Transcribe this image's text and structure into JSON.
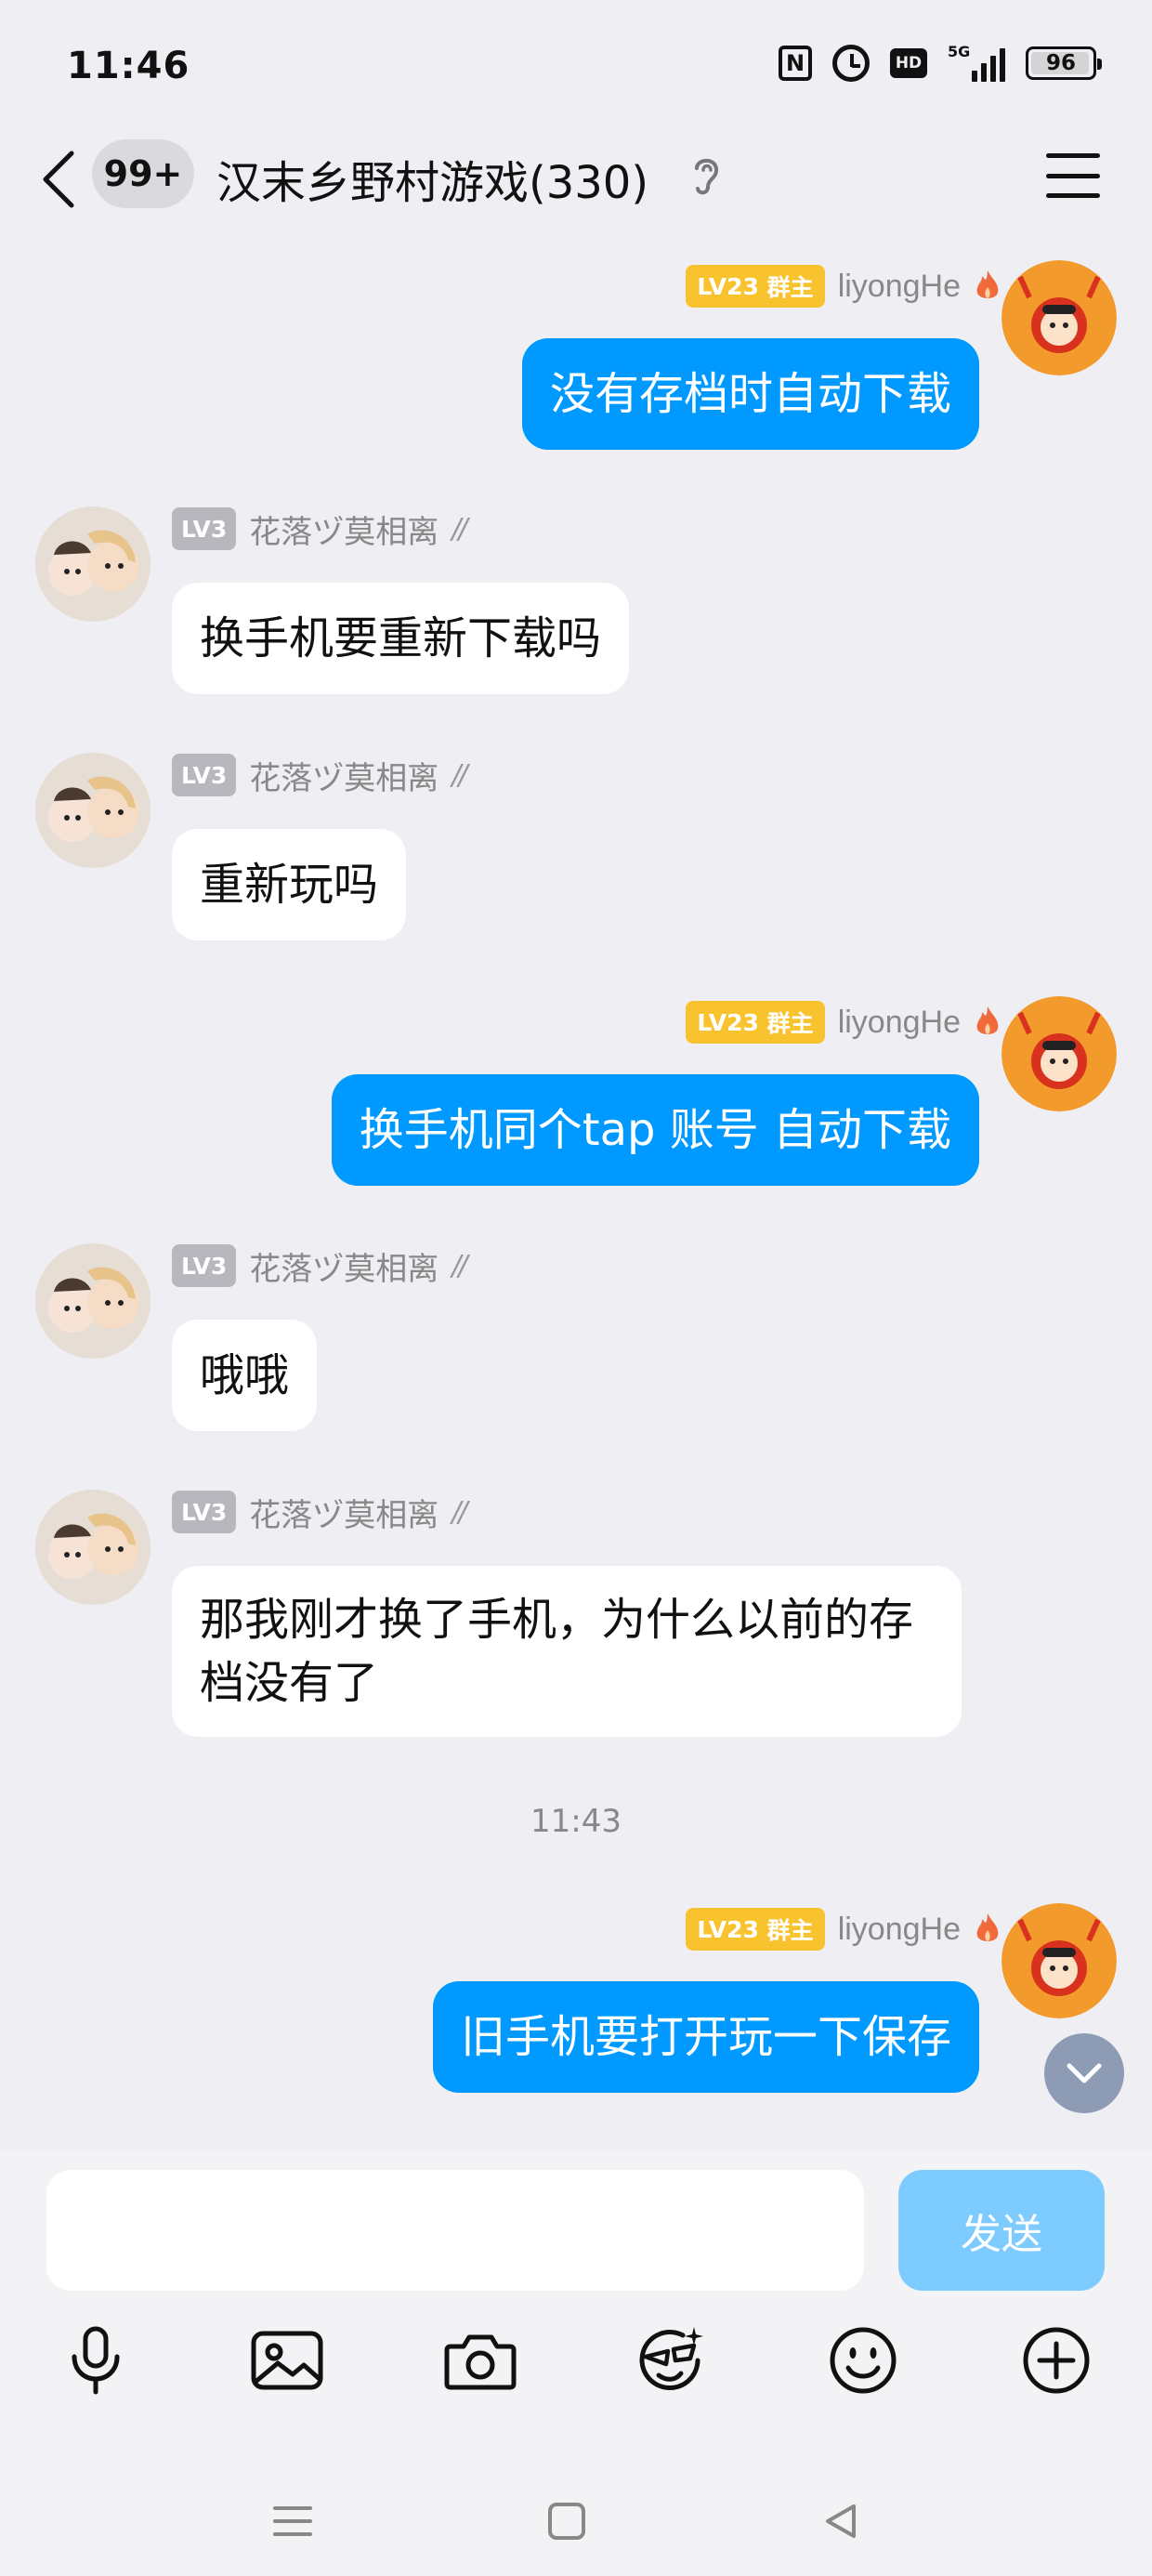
{
  "status_bar": {
    "time": "11:46",
    "network": "5G",
    "battery": "96",
    "icons": [
      "nfc-icon",
      "alarm-icon",
      "hd-icon",
      "signal-icon",
      "battery-icon"
    ]
  },
  "header": {
    "unread_count": "99+",
    "title": "汉末乡野村游戏(330)",
    "icons": [
      "back-arrow-icon",
      "ear-icon",
      "menu-icon"
    ]
  },
  "colors": {
    "outgoing_bubble": "#0099ff",
    "incoming_bubble": "#ffffff",
    "background": "#eeeef3",
    "owner_badge": "#f8c32f",
    "level_badge": "#b7b7bd",
    "send_button": "#7ecbff"
  },
  "messages": [
    {
      "direction": "out",
      "level": "LV23",
      "role": "群主",
      "sender": "liyongHe",
      "text": "没有存档时自动下载"
    },
    {
      "direction": "in",
      "level": "LV3",
      "sender": "花落ヅ莫相离",
      "text": "换手机要重新下载吗"
    },
    {
      "direction": "in",
      "level": "LV3",
      "sender": "花落ヅ莫相离",
      "text": "重新玩吗"
    },
    {
      "direction": "out",
      "level": "LV23",
      "role": "群主",
      "sender": "liyongHe",
      "text": "换手机同个tap 账号 自动下载"
    },
    {
      "direction": "in",
      "level": "LV3",
      "sender": "花落ヅ莫相离",
      "text": "哦哦"
    },
    {
      "direction": "in",
      "level": "LV3",
      "sender": "花落ヅ莫相离",
      "text": "那我刚才换了手机，为什么以前的存档没有了"
    },
    {
      "direction": "out",
      "level": "LV23",
      "role": "群主",
      "sender": "liyongHe",
      "text": "旧手机要打开玩一下保存"
    }
  ],
  "timestamp": "11:43",
  "composer": {
    "input_value": "",
    "send_label": "发送",
    "tools": [
      "microphone-icon",
      "image-icon",
      "camera-icon",
      "sticker-icon",
      "emoji-icon",
      "plus-icon"
    ]
  },
  "navbar": [
    "menu-nav-icon",
    "home-nav-icon",
    "back-nav-icon"
  ]
}
